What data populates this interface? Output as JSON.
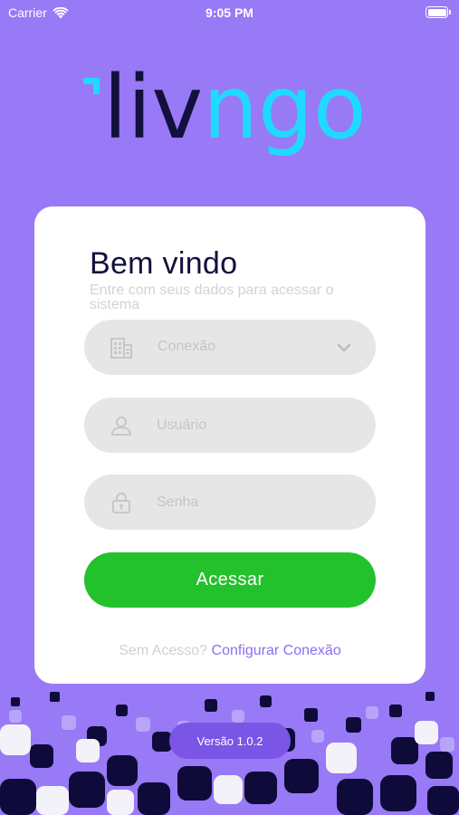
{
  "status_bar": {
    "carrier": "Carrier",
    "time": "9:05 PM"
  },
  "logo": {
    "text_dark": "liv",
    "text_light": "ngo"
  },
  "login": {
    "title": "Bem vindo",
    "subtitle": "Entre com seus dados para acessar o sistema",
    "connection_field": {
      "icon": "building-icon",
      "placeholder": "Conexão"
    },
    "user_field": {
      "icon": "user-icon",
      "placeholder": "Usuário",
      "value": ""
    },
    "password_field": {
      "icon": "lock-icon",
      "placeholder": "Senha",
      "value": ""
    },
    "submit_label": "Acessar",
    "no_access_text": "Sem Acesso?",
    "configure_link": "Configurar Conexão"
  },
  "version_label": "Versão 1.0.2",
  "colors": {
    "background": "#9879f6",
    "card": "#ffffff",
    "title": "#12103d",
    "button": "#23c12c",
    "link": "#8c6ef2",
    "logo_dark": "#12103d",
    "logo_accent": "#20d9ff",
    "pattern_dark": "#0e0b3a",
    "version_pill": "#7b55e6"
  }
}
